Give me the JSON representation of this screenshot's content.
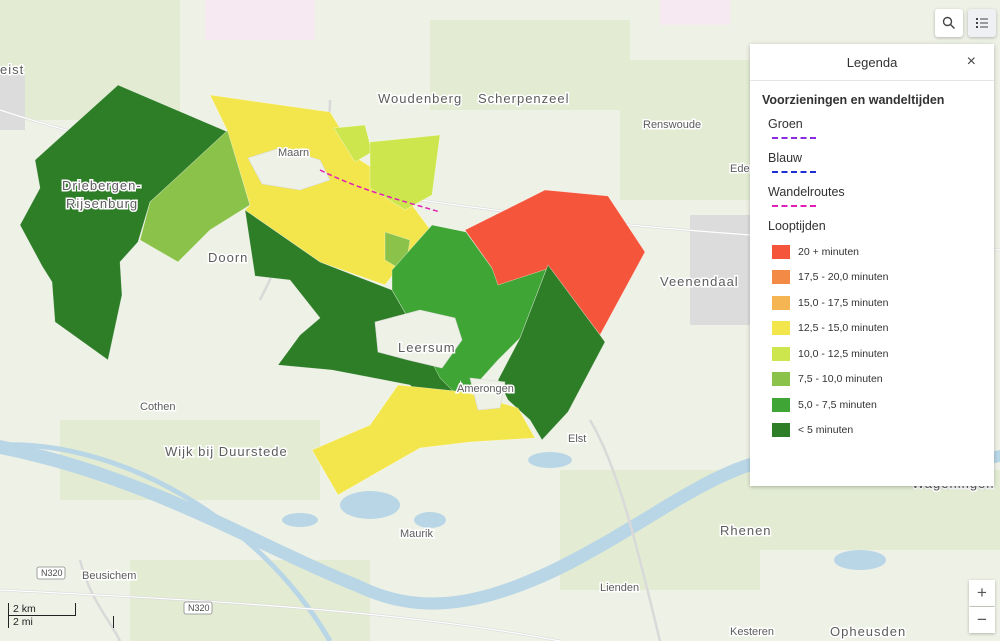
{
  "map": {
    "places": [
      {
        "name": "Woudenberg",
        "kind": "town"
      },
      {
        "name": "Scherpenzeel",
        "kind": "town"
      },
      {
        "name": "Renswoude",
        "kind": "small"
      },
      {
        "name": "Maarn",
        "kind": "small"
      },
      {
        "name": "Driebergen-",
        "kind": "town"
      },
      {
        "name": "Rijsenburg",
        "kind": "town"
      },
      {
        "name": "Doorn",
        "kind": "town"
      },
      {
        "name": "Veenendaal",
        "kind": "town"
      },
      {
        "name": "Leersum",
        "kind": "town"
      },
      {
        "name": "Amerongen",
        "kind": "small"
      },
      {
        "name": "Cothen",
        "kind": "small"
      },
      {
        "name": "Elst",
        "kind": "small"
      },
      {
        "name": "Wijk bij Duurstede",
        "kind": "town"
      },
      {
        "name": "Maurik",
        "kind": "small"
      },
      {
        "name": "Beusichem",
        "kind": "small"
      },
      {
        "name": "Rhenen",
        "kind": "town"
      },
      {
        "name": "Lienden",
        "kind": "small"
      },
      {
        "name": "Wageningen",
        "kind": "town"
      },
      {
        "name": "Kesteren",
        "kind": "small"
      },
      {
        "name": "Opheusden",
        "kind": "town"
      },
      {
        "name": "Eden",
        "kind": "small"
      },
      {
        "name": "eist",
        "kind": "town"
      }
    ],
    "roads": [
      "N320",
      "N320"
    ]
  },
  "toolbar": {
    "search_icon": "search-icon",
    "legend_icon": "legend-list-icon"
  },
  "legend": {
    "title": "Legenda",
    "close": "×",
    "layer_title": "Voorzieningen en wandeltijden",
    "routes": [
      {
        "label": "Groen",
        "color": "#8a2be2"
      },
      {
        "label": "Blauw",
        "color": "#1f2fd6"
      },
      {
        "label": "Wandelroutes",
        "color": "#e21fb5"
      }
    ],
    "times_title": "Looptijden",
    "times": [
      {
        "label": "20 + minuten",
        "color": "#f5553a"
      },
      {
        "label": "17,5 - 20,0 minuten",
        "color": "#f38a45"
      },
      {
        "label": "15,0 - 17,5 minuten",
        "color": "#f5b553"
      },
      {
        "label": "12,5 - 15,0 minuten",
        "color": "#f3e64c"
      },
      {
        "label": "10,0 - 12,5 minuten",
        "color": "#cde64d"
      },
      {
        "label": "7,5 - 10,0 minuten",
        "color": "#8bc34a"
      },
      {
        "label": "5,0 - 7,5 minuten",
        "color": "#3fa535"
      },
      {
        "label": "< 5 minuten",
        "color": "#2e7d27"
      }
    ]
  },
  "zoom": {
    "in": "+",
    "out": "−"
  },
  "scale": {
    "km": "2 km",
    "mi": "2 mi"
  }
}
